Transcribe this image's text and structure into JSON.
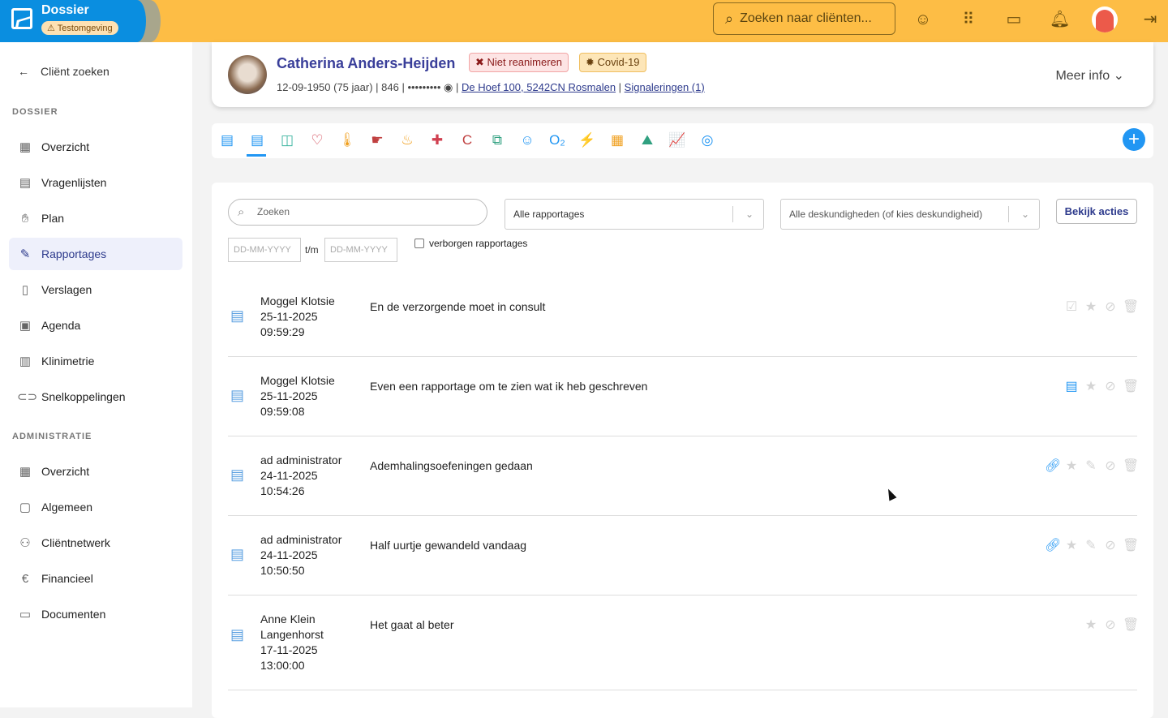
{
  "header": {
    "app_title": "Dossier",
    "env_badge": "Testomgeving",
    "search_placeholder": "Zoeken naar cliënten...",
    "colors": {
      "topbar": "#fdbd45",
      "brand": "#0a8ee0"
    },
    "icons": [
      "smile-plus-icon",
      "apps-grid-icon",
      "chat-icon",
      "bell-icon",
      "user-avatar",
      "logout-icon"
    ]
  },
  "sidebar": {
    "back": "Cliënt zoeken",
    "section1": "DOSSIER",
    "items1": [
      {
        "label": "Overzicht",
        "icon": "grid-icon"
      },
      {
        "label": "Vragenlijsten",
        "icon": "questionnaire-icon"
      },
      {
        "label": "Plan",
        "icon": "hand-plan-icon"
      },
      {
        "label": "Rapportages",
        "icon": "report-icon",
        "active": true
      },
      {
        "label": "Verslagen",
        "icon": "file-icon"
      },
      {
        "label": "Agenda",
        "icon": "calendar-icon"
      },
      {
        "label": "Klinimetrie",
        "icon": "bar-chart-icon"
      },
      {
        "label": "Snelkoppelingen",
        "icon": "link-icon"
      }
    ],
    "section2": "ADMINISTRATIE",
    "items2": [
      {
        "label": "Overzicht",
        "icon": "grid-icon"
      },
      {
        "label": "Algemeen",
        "icon": "user-card-icon"
      },
      {
        "label": "Cliëntnetwerk",
        "icon": "network-icon"
      },
      {
        "label": "Financieel",
        "icon": "euro-icon"
      },
      {
        "label": "Documenten",
        "icon": "folder-icon"
      }
    ]
  },
  "patient": {
    "name": "Catherina Anders-Heijden",
    "tags": [
      "Niet reanimeren",
      "Covid-19"
    ],
    "dob": "12-09-1950 (75 jaar)",
    "id": "846",
    "masked": "•••••••••",
    "address": "De Hoef 100, 5242CN Rosmalen",
    "signals": "Signaleringen (1)",
    "more": "Meer info"
  },
  "toolbar": {
    "icons": [
      {
        "name": "document-icon",
        "glyph": "▤",
        "color": "#2196f3"
      },
      {
        "name": "report-icon",
        "glyph": "▤",
        "color": "#2196f3"
      },
      {
        "name": "scale-icon",
        "glyph": "◫",
        "color": "#3cb5a0"
      },
      {
        "name": "heart-rate-icon",
        "glyph": "♡",
        "color": "#d04050"
      },
      {
        "name": "thermometer-icon",
        "glyph": "🌡",
        "color": "#f0a020"
      },
      {
        "name": "hand-icon",
        "glyph": "☛",
        "color": "#c04040"
      },
      {
        "name": "toilet-icon",
        "glyph": "♨",
        "color": "#f0a020"
      },
      {
        "name": "cross-icon",
        "glyph": "✚",
        "color": "#d04050"
      },
      {
        "name": "c-icon",
        "glyph": "C",
        "color": "#c04040"
      },
      {
        "name": "transfer-icon",
        "glyph": "⧉",
        "color": "#30a080"
      },
      {
        "name": "smiley-icon",
        "glyph": "☺",
        "color": "#2196f3"
      },
      {
        "name": "oxygen-icon",
        "glyph": "O₂",
        "color": "#2196f3"
      },
      {
        "name": "pain-icon",
        "glyph": "⚡",
        "color": "#c04040"
      },
      {
        "name": "soep-icon",
        "glyph": "▦",
        "color": "#f0a020"
      },
      {
        "name": "stool-icon",
        "glyph": "⛰",
        "color": "#30a080"
      },
      {
        "name": "line-chart-icon",
        "glyph": "📈",
        "color": "#30a080"
      },
      {
        "name": "camera-icon",
        "glyph": "◎",
        "color": "#2196f3"
      }
    ]
  },
  "filters": {
    "search_placeholder": "Zoeken",
    "type_select": "Alle rapportages",
    "expertise_select": "Alle deskundigheden (of kies deskundigheid)",
    "actions_button": "Bekijk acties",
    "date_from": "DD-MM-YYYY",
    "date_sep": "t/m",
    "date_to": "DD-MM-YYYY",
    "hidden_checkbox": "verborgen rapportages"
  },
  "reports": [
    {
      "author": "Moggel Klotsie",
      "date": "25-11-2025",
      "time": "09:59:29",
      "text": "En de verzorgende moet in consult",
      "actions": [
        "check-copy-icon",
        "star-icon",
        "hide-icon",
        "trash-icon"
      ]
    },
    {
      "author": "Moggel Klotsie",
      "date": "25-11-2025",
      "time": "09:59:08",
      "text": "Even een rapportage om te zien wat ik heb geschreven",
      "actions": [
        "document-icon",
        "star-icon",
        "hide-icon",
        "trash-icon"
      ]
    },
    {
      "author": "ad administrator",
      "date": "24-11-2025",
      "time": "10:54:26",
      "text": "Ademhalingsoefeningen gedaan",
      "actions": [
        "attachment-icon",
        "star-icon",
        "edit-icon",
        "hide-icon",
        "trash-icon"
      ]
    },
    {
      "author": "ad administrator",
      "date": "24-11-2025",
      "time": "10:50:50",
      "text": "Half uurtje gewandeld vandaag",
      "actions": [
        "attachment-icon",
        "star-icon",
        "edit-icon",
        "hide-icon",
        "trash-icon"
      ]
    },
    {
      "author": "Anne Klein Langenhorst",
      "date": "17-11-2025",
      "time": "13:00:00",
      "text": "Het gaat al beter",
      "actions": [
        "star-icon",
        "hide-icon",
        "trash-icon"
      ]
    }
  ]
}
